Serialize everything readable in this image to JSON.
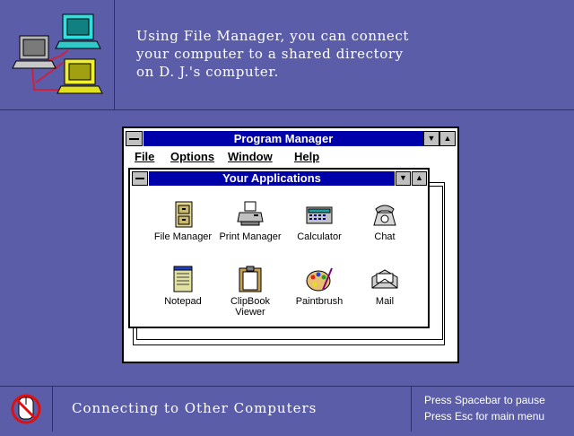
{
  "header": {
    "message_line1": "Using File Manager, you can connect",
    "message_line2": "your computer to a shared directory",
    "message_line3": "on D. J.'s computer."
  },
  "program_manager": {
    "title": "Program Manager",
    "menu": [
      {
        "label": "File"
      },
      {
        "label": "Options"
      },
      {
        "label": "Window"
      },
      {
        "label": "Help"
      }
    ]
  },
  "group_window": {
    "title": "Your Applications",
    "apps": [
      {
        "label": "File Manager",
        "icon": "file-manager-icon"
      },
      {
        "label": "Print Manager",
        "icon": "print-manager-icon"
      },
      {
        "label": "Calculator",
        "icon": "calculator-icon"
      },
      {
        "label": "Chat",
        "icon": "chat-icon"
      },
      {
        "label": "Notepad",
        "icon": "notepad-icon"
      },
      {
        "label": "ClipBook Viewer",
        "icon": "clipbook-viewer-icon"
      },
      {
        "label": "Paintbrush",
        "icon": "paintbrush-icon"
      },
      {
        "label": "Mail",
        "icon": "mail-icon"
      }
    ]
  },
  "footer": {
    "title": "Connecting to Other Computers",
    "hint_pause": "Press Spacebar to pause",
    "hint_menu": "Press Esc for main menu"
  },
  "colors": {
    "background": "#5b5da8",
    "titlebar": "#0000aa"
  }
}
